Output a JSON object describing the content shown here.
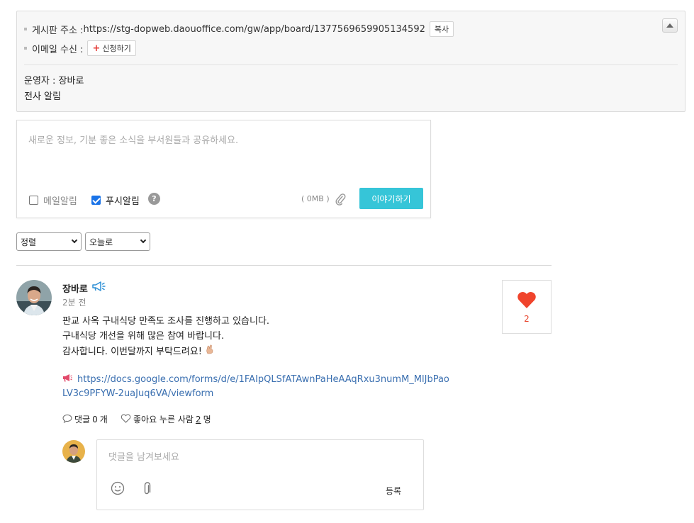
{
  "board_info": {
    "address_label": "게시판 주소 :",
    "address_url": "https://stg-dopweb.daouoffice.com/gw/app/board/1377569659905134592",
    "copy_button": "복사",
    "email_label": "이메일 수신 :",
    "subscribe_button": "신청하기",
    "operator": "운영자 : 장바로",
    "description": "전사 알림"
  },
  "composer": {
    "placeholder": "새로운 정보, 기분 좋은 소식을 부서원들과 공유하세요.",
    "mail_alert": "메일알림",
    "mail_alert_checked": false,
    "push_alert": "푸시알림",
    "push_alert_checked": true,
    "help": "?",
    "attachment_size": "( 0MB )",
    "submit": "이야기하기"
  },
  "filters": {
    "sort": "정렬",
    "date": "오늘로"
  },
  "post": {
    "author": "장바로",
    "time": "2분 전",
    "lines": [
      "판교 사옥 구내식당 만족도 조사를 진행하고 있습니다.",
      "구내식당 개선을 위해 많은 참여 바랍니다.",
      "감사합니다. 이번달까지 부탁드려요!"
    ],
    "link_line1": "https://docs.google.com/forms/d/e/1FAIpQLSfATAwnPaHeAAqRxu3numM_MlJbPao",
    "link_line2": "LV3c9PFYW-2uaJuq6VA/viewform",
    "like_count": "2",
    "comments_label": "댓글",
    "comments_count": "0",
    "comments_unit": "개",
    "likes_label": "좋아요 누른 사람",
    "likes_people": "2",
    "likes_unit": "명"
  },
  "comment": {
    "placeholder": "댓글을 남겨보세요",
    "submit": "등록"
  },
  "colors": {
    "accent": "#36c5d8",
    "heart": "#e8442c",
    "link": "#3a6fb0"
  }
}
